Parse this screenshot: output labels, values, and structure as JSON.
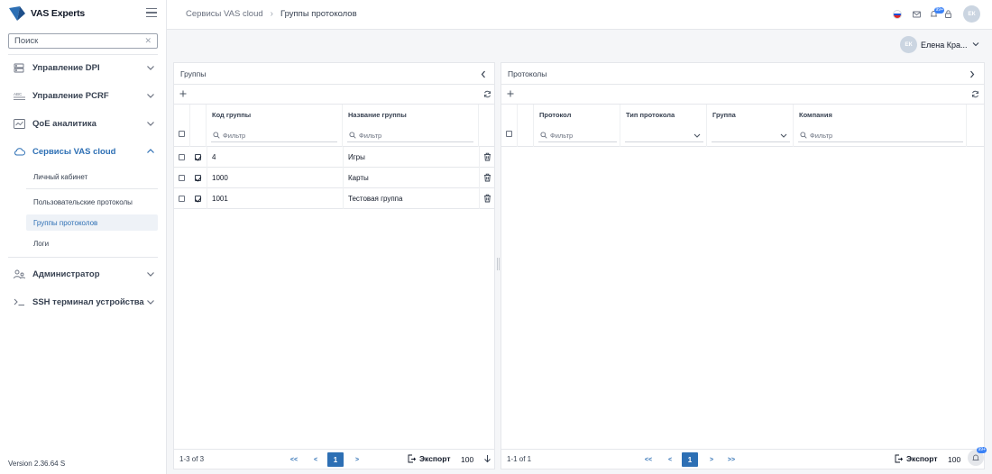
{
  "brand": {
    "name": "VAS Experts"
  },
  "sidebar": {
    "search_placeholder": "Поиск",
    "items": [
      {
        "label": "Управление DPI",
        "icon": "server-icon"
      },
      {
        "label": "Управление PCRF",
        "icon": "pcrf-icon"
      },
      {
        "label": "QoE аналитика",
        "icon": "chart-icon"
      },
      {
        "label": "Сервисы VAS cloud",
        "icon": "cloud-icon"
      },
      {
        "label": "Администратор",
        "icon": "users-icon"
      },
      {
        "label": "SSH терминал устройства",
        "icon": "terminal-icon"
      }
    ],
    "subitems": [
      {
        "label": "Личный кабинет"
      },
      {
        "label": "Пользовательские протоколы"
      },
      {
        "label": "Группы протоколов"
      },
      {
        "label": "Логи"
      }
    ],
    "version": "Version 2.36.64 S"
  },
  "header": {
    "breadcrumb": [
      "Сервисы VAS cloud",
      "Группы протоколов"
    ],
    "notif_badge": "99+",
    "avatar_initials": "ЕК"
  },
  "user": {
    "initials": "ЕК",
    "name": "Елена Кра..."
  },
  "groups_panel": {
    "title": "Группы",
    "columns": [
      "Код группы",
      "Название группы"
    ],
    "filter_placeholder": "Фильтр",
    "rows": [
      {
        "code": "4",
        "name": "Игры"
      },
      {
        "code": "1000",
        "name": "Карты"
      },
      {
        "code": "1001",
        "name": "Тестовая группа"
      }
    ],
    "pager": {
      "count": "1-3 of 3",
      "first": "<<",
      "prev": "<",
      "page": "1",
      "next": ">",
      "export": "Экспорт",
      "per_page": "100"
    }
  },
  "protocols_panel": {
    "title": "Протоколы",
    "columns": [
      "Протокол",
      "Тип протокола",
      "Группа",
      "Компания"
    ],
    "filter_placeholder": "Фильтр",
    "pager": {
      "count": "1-1 of 1",
      "first": "<<",
      "prev": "<",
      "page": "1",
      "next": ">",
      "last": ">>",
      "export": "Экспорт",
      "per_page": "100"
    }
  },
  "fab_badge": "99+",
  "colors": {
    "accent": "#2d6fb4",
    "badge": "#3b82f6"
  }
}
